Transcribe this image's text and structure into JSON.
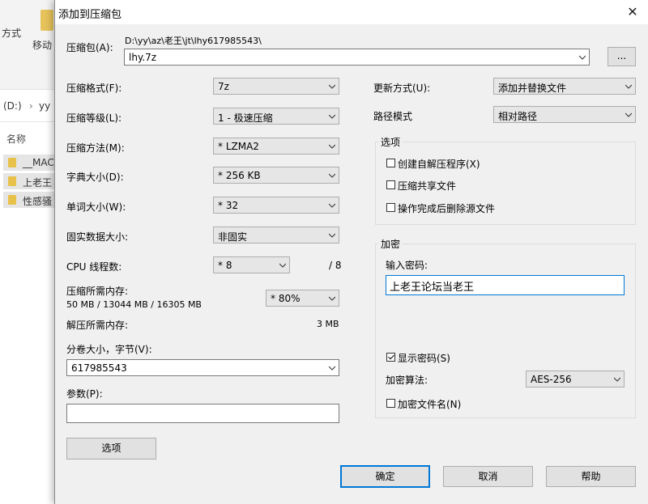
{
  "background": {
    "ribbon_text_1": "方式",
    "ribbon_text_2": "移动",
    "path_drive": "(D:)",
    "path_sep": "›",
    "path_folder": "yy",
    "column_name": "名称",
    "files": [
      "__MAC",
      "上老王",
      "性感骚"
    ]
  },
  "dialog": {
    "title": "添加到压缩包",
    "close_glyph": "✕",
    "archive_label": "压缩包(A):",
    "archive_path": "D:\\yy\\az\\老王\\jt\\lhy617985543\\",
    "archive_name": "lhy.7z",
    "browse_label": "...",
    "left": {
      "format": {
        "label": "压缩格式(F):",
        "value": "7z"
      },
      "level": {
        "label": "压缩等级(L):",
        "value": "1 - 极速压缩"
      },
      "method": {
        "label": "压缩方法(M):",
        "value": "* LZMA2"
      },
      "dict_size": {
        "label": "字典大小(D):",
        "value": "* 256 KB"
      },
      "word_size": {
        "label": "单词大小(W):",
        "value": "* 32"
      },
      "solid_size": {
        "label": "固实数据大小:",
        "value": "非固实"
      },
      "cpu_threads": {
        "label": "CPU 线程数:",
        "value": "* 8",
        "max": "/ 8"
      },
      "mem_compress": {
        "label": "压缩所需内存:",
        "detail": "50 MB / 13044 MB / 16305 MB",
        "value": "* 80%"
      },
      "mem_decompress": {
        "label": "解压所需内存:",
        "value": "3 MB"
      },
      "volume_size": {
        "label": "分卷大小，字节(V):",
        "value": "617985543"
      },
      "params": {
        "label": "参数(P):",
        "value": ""
      },
      "options_button": "选项"
    },
    "right": {
      "update_mode": {
        "label": "更新方式(U):",
        "value": "添加并替换文件"
      },
      "path_mode": {
        "label": "路径模式",
        "value": "相对路径"
      },
      "options_group": {
        "title": "选项",
        "sfx": {
          "label": "创建自解压程序(X)",
          "checked": false
        },
        "shared": {
          "label": "压缩共享文件",
          "checked": false
        },
        "delete_after": {
          "label": "操作完成后删除源文件",
          "checked": false
        }
      },
      "encryption_group": {
        "title": "加密",
        "password_label": "输入密码:",
        "password_value": "上老王论坛当老王",
        "show_password": {
          "label": "显示密码(S)",
          "checked": true
        },
        "method_label": "加密算法:",
        "method_value": "AES-256",
        "encrypt_names": {
          "label": "加密文件名(N)",
          "checked": false
        }
      }
    },
    "buttons": {
      "ok": "确定",
      "cancel": "取消",
      "help": "帮助"
    }
  }
}
